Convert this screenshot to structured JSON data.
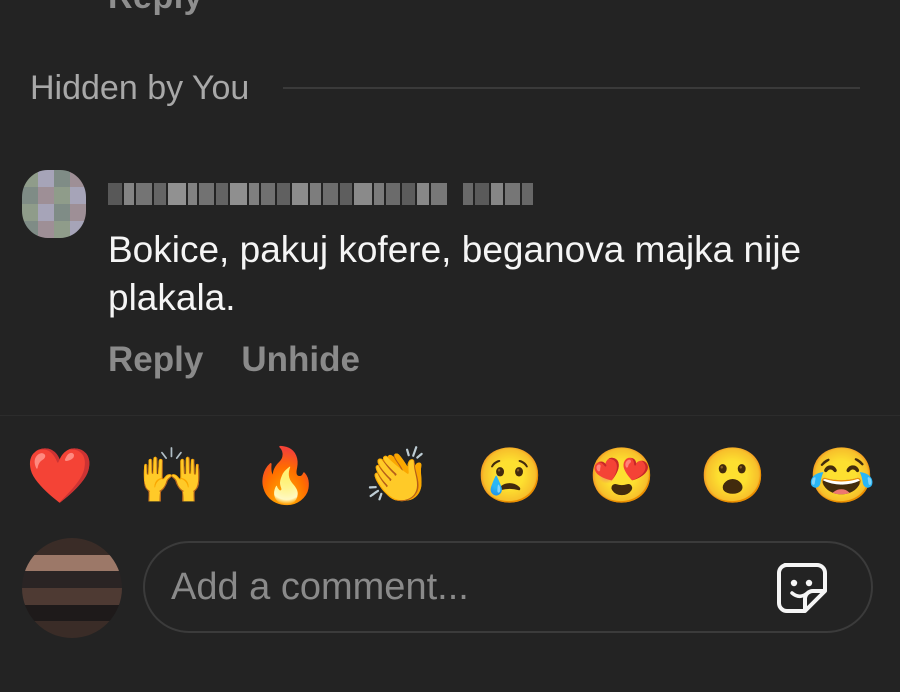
{
  "top_cut_text": "Reply",
  "hidden_section": {
    "title": "Hidden by You"
  },
  "comment": {
    "text": "Bokice, pakuj kofere, beganova majka nije plakala.",
    "actions": {
      "reply": "Reply",
      "unhide": "Unhide"
    }
  },
  "reactions": [
    {
      "emoji": "❤️",
      "name": "heart"
    },
    {
      "emoji": "🙌",
      "name": "raising-hands"
    },
    {
      "emoji": "🔥",
      "name": "fire"
    },
    {
      "emoji": "👏",
      "name": "clapping-hands"
    },
    {
      "emoji": "😢",
      "name": "crying-face"
    },
    {
      "emoji": "😍",
      "name": "heart-eyes"
    },
    {
      "emoji": "😮",
      "name": "surprised-face"
    },
    {
      "emoji": "😂",
      "name": "tears-of-joy"
    }
  ],
  "composer": {
    "placeholder": "Add a comment...",
    "sticker_icon": "sticker-icon"
  },
  "colors": {
    "background": "#232323",
    "muted_text": "#8a8a8a",
    "primary_text": "#f5f5f5"
  }
}
